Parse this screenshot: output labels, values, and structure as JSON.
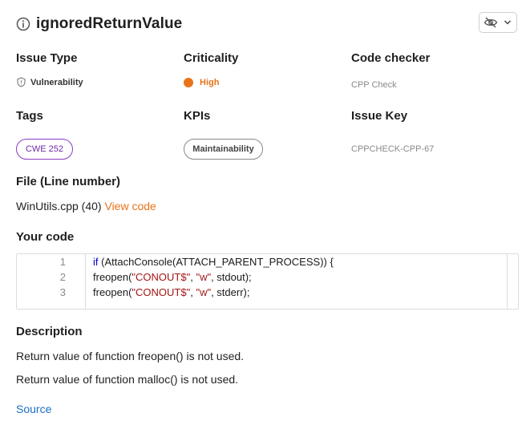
{
  "header": {
    "title": "ignoredReturnValue"
  },
  "details": {
    "issue_type_label": "Issue Type",
    "issue_type_value": "Vulnerability",
    "criticality_label": "Criticality",
    "criticality_value": "High",
    "code_checker_label": "Code checker",
    "code_checker_value": "CPP Check",
    "tags_label": "Tags",
    "tag_value": "CWE 252",
    "kpis_label": "KPIs",
    "kpi_value": "Maintainability",
    "issue_key_label": "Issue Key",
    "issue_key_value": "CPPCHECK-CPP-67"
  },
  "file": {
    "label": "File (Line number)",
    "value": "WinUtils.cpp (40)",
    "view_code": "View code"
  },
  "code": {
    "label": "Your code",
    "lines": [
      {
        "num": "1",
        "parts": [
          {
            "t": "if",
            "c": "kw"
          },
          {
            "t": " (AttachConsole(ATTACH_PARENT_PROCESS)) {",
            "c": ""
          }
        ]
      },
      {
        "num": "2",
        "parts": [
          {
            "t": "freopen(",
            "c": ""
          },
          {
            "t": "\"CONOUT$\"",
            "c": "str"
          },
          {
            "t": ", ",
            "c": ""
          },
          {
            "t": "\"w\"",
            "c": "str"
          },
          {
            "t": ", stdout);",
            "c": ""
          }
        ]
      },
      {
        "num": "3",
        "parts": [
          {
            "t": "freopen(",
            "c": ""
          },
          {
            "t": "\"CONOUT$\"",
            "c": "str"
          },
          {
            "t": ", ",
            "c": ""
          },
          {
            "t": "\"w\"",
            "c": "str"
          },
          {
            "t": ", stderr);",
            "c": ""
          }
        ]
      }
    ]
  },
  "description": {
    "label": "Description",
    "line1": "Return value of function freopen() is not used.",
    "line2": "Return value of function malloc() is not used."
  },
  "source_link": "Source",
  "colors": {
    "accent": "#e8731a",
    "tag_purple": "#8a3cc7",
    "link_blue": "#1a6fc4"
  },
  "icons": [
    "info-icon",
    "eye-off-icon",
    "chevron-down-icon",
    "shield-icon"
  ]
}
